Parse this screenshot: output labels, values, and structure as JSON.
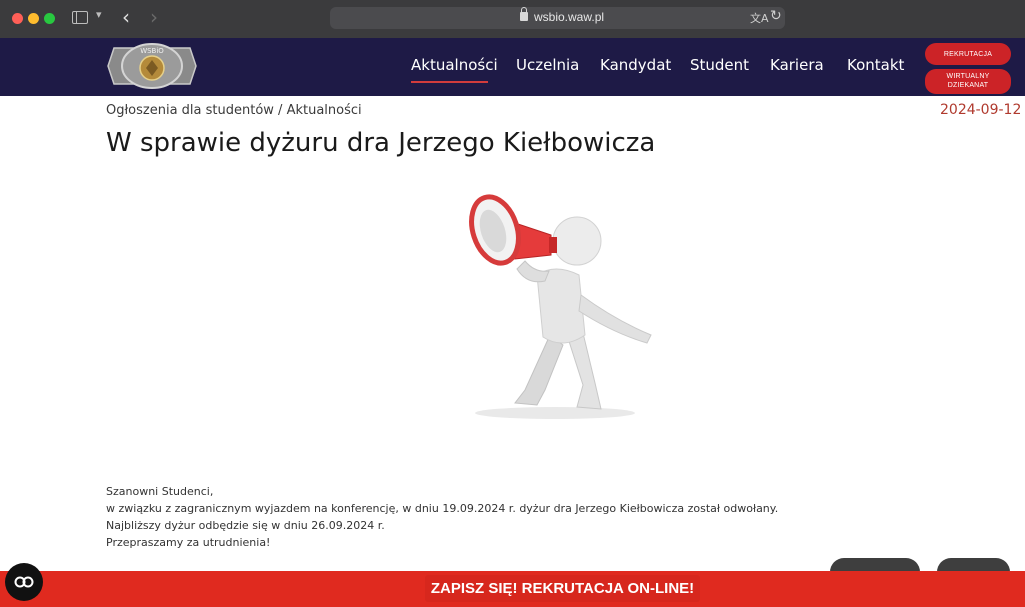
{
  "browser": {
    "url": "wsbio.waw.pl",
    "icons": [
      "sidebar-icon",
      "chevron-down-icon",
      "back-icon",
      "forward-icon",
      "lock-icon",
      "translate-icon",
      "reload-icon"
    ]
  },
  "header": {
    "logo_text": "WSBiO",
    "nav": [
      "Aktualności",
      "Uczelnia",
      "Kandydat",
      "Student",
      "Kariera",
      "Kontakt"
    ],
    "active_nav": "Aktualności",
    "pills": {
      "rekrutacja": "REKRUTACJA",
      "dziekanat_line1": "WIRTUALNY",
      "dziekanat_line2": "DZIEKANAT"
    },
    "colors": {
      "background": "#1e1a46",
      "accent": "#cc2327"
    }
  },
  "content": {
    "breadcrumb": "Ogłoszenia dla studentów / Aktualności",
    "date": "2024-09-12",
    "title": "W sprawie dyżuru dra Jerzego Kiełbowicza",
    "illustration": "megaphone-figure-illustration",
    "body": [
      "Szanowni Studenci,",
      "w związku z zagranicznym wyjazdem na konferencję, w dniu 19.09.2024 r. dyżur dra Jerzego Kiełbowicza został odwołany.",
      "Najbliższy dyżur odbędzie się w dniu 26.09.2024 r.",
      "Przepraszamy za utrudnienia!"
    ]
  },
  "banner": {
    "label": "ZAPISZ SIĘ! REKRUTACJA ON-LINE!",
    "color": "#e02a1f"
  },
  "accessibility_button": "accessibility-icon"
}
